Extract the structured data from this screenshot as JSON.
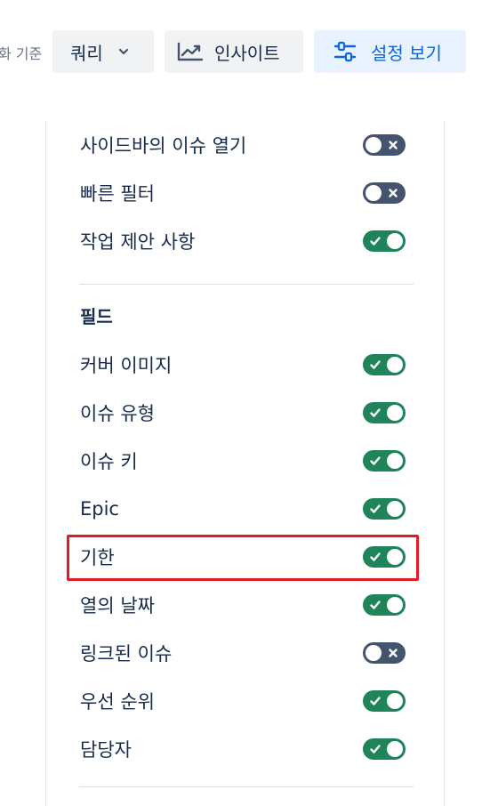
{
  "toolbar": {
    "group_by_label": "화 기준",
    "query_label": "쿼리",
    "insight_label": "인사이트",
    "settings_label": "설정 보기"
  },
  "settings": {
    "top_items": [
      {
        "label": "사이드바의 이슈 열기",
        "enabled": false
      },
      {
        "label": "빠른 필터",
        "enabled": false
      },
      {
        "label": "작업 제안 사항",
        "enabled": true
      }
    ],
    "fields_title": "필드",
    "field_items": [
      {
        "label": "커버 이미지",
        "enabled": true
      },
      {
        "label": "이슈 유형",
        "enabled": true
      },
      {
        "label": "이슈 키",
        "enabled": true
      },
      {
        "label": "Epic",
        "enabled": true
      },
      {
        "label": "기한",
        "enabled": true
      },
      {
        "label": "열의 날짜",
        "enabled": true
      },
      {
        "label": "링크된 이슈",
        "enabled": false
      },
      {
        "label": "우선 순위",
        "enabled": true
      },
      {
        "label": "담당자",
        "enabled": true
      }
    ]
  },
  "colors": {
    "toggle_on": "#1f845a",
    "toggle_off": "#44546f",
    "highlight": "#e01b24",
    "accent": "#0c66e4"
  },
  "icons": {
    "query_chevron": "chevron-down-icon",
    "insight": "line-chart-icon",
    "settings": "sliders-icon"
  }
}
